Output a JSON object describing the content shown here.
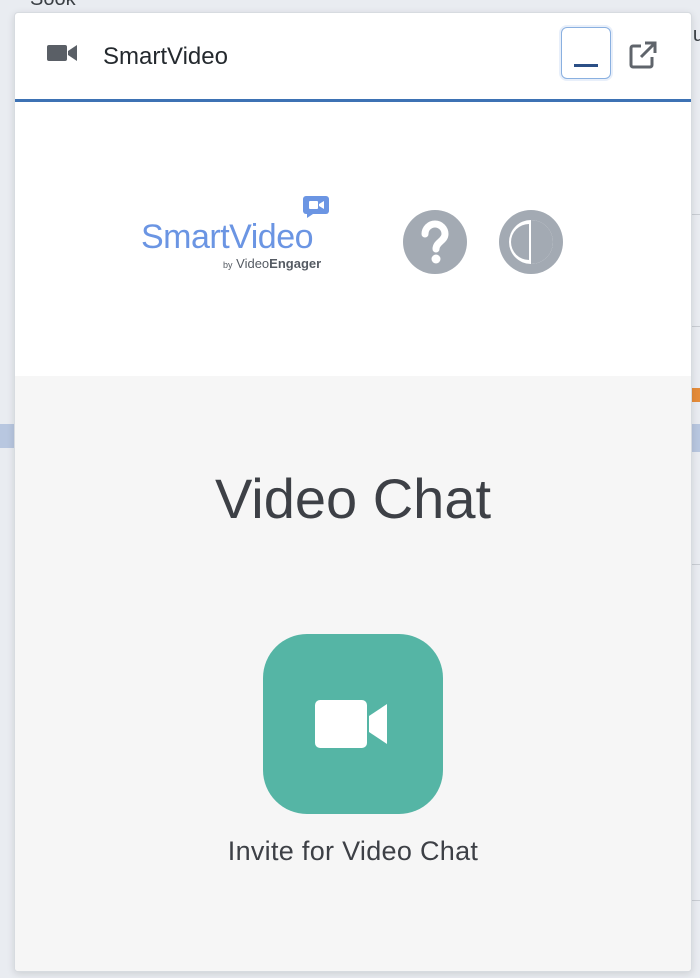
{
  "background": {
    "partial_text": "Sook",
    "partial_right_text": "u"
  },
  "header": {
    "title": "SmartVideo",
    "icons": {
      "left": "video-camera-icon",
      "minimize": "minimize-icon",
      "popout": "external-link-icon"
    }
  },
  "brand": {
    "logo_main": "SmartVideo",
    "logo_by": "by",
    "logo_vendor_prefix": "Video",
    "logo_vendor_suffix": "Engager",
    "icons": {
      "help": "question-mark-icon",
      "contrast": "contrast-icon"
    }
  },
  "main": {
    "title": "Video Chat",
    "invite_label": "Invite for Video Chat",
    "icons": {
      "invite": "video-camera-icon"
    }
  },
  "colors": {
    "accent_blue": "#3d72b4",
    "logo_blue": "#6b95e3",
    "invite_green": "#55b5a5",
    "icon_gray": "#a3aab3"
  }
}
